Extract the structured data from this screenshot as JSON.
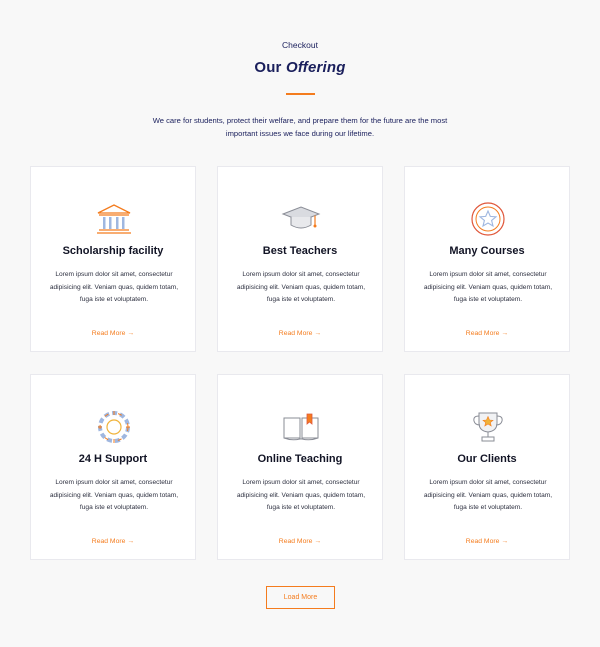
{
  "header": {
    "eyebrow": "Checkout",
    "title_part1": "Our",
    "title_part2": "Offering",
    "intro": "We care for students, protect their welfare, and prepare them for the future are the most important issues we face during our lifetime."
  },
  "cards": [
    {
      "title": "Scholarship facility",
      "icon": "bank-building-icon",
      "text": "Lorem ipsum dolor sit amet, consectetur adipisicing elit. Veniam quas, quidem totam, fuga iste et voluptatem.",
      "link": "Read More"
    },
    {
      "title": "Best Teachers",
      "icon": "graduation-cap-icon",
      "text": "Lorem ipsum dolor sit amet, consectetur adipisicing elit. Veniam quas, quidem totam, fuga iste et voluptatem.",
      "link": "Read More"
    },
    {
      "title": "Many Courses",
      "icon": "star-badge-icon",
      "text": "Lorem ipsum dolor sit amet, consectetur adipisicing elit. Veniam quas, quidem totam, fuga iste et voluptatem.",
      "link": "Read More"
    },
    {
      "title": "24 H Support",
      "icon": "lifebuoy-icon",
      "text": "Lorem ipsum dolor sit amet, consectetur adipisicing elit. Veniam quas, quidem totam, fuga iste et voluptatem.",
      "link": "Read More"
    },
    {
      "title": "Online Teaching",
      "icon": "open-book-icon",
      "text": "Lorem ipsum dolor sit amet, consectetur adipisicing elit. Veniam quas, quidem totam, fuga iste et voluptatem.",
      "link": "Read More"
    },
    {
      "title": "Our Clients",
      "icon": "trophy-icon",
      "text": "Lorem ipsum dolor sit amet, consectetur adipisicing elit. Veniam quas, quidem totam, fuga iste et voluptatem.",
      "link": "Read More"
    }
  ],
  "load_more": "Load More",
  "colors": {
    "accent": "#f47c1e",
    "heading": "#1a1f5c",
    "background": "#f8f8f8",
    "card": "#ffffff"
  }
}
